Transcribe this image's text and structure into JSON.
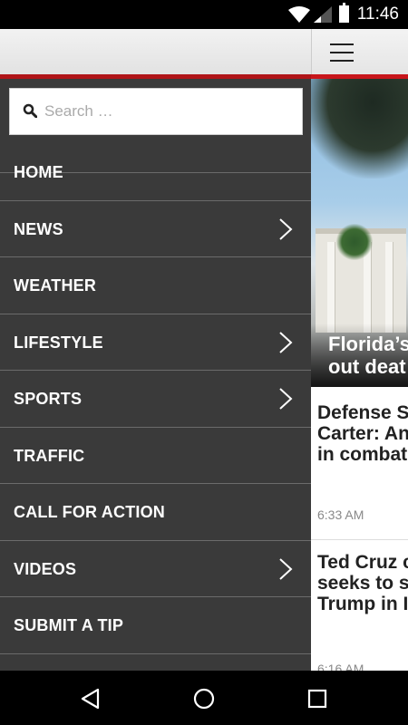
{
  "status_bar": {
    "time": "11:46",
    "icons": [
      "wifi-icon",
      "signal-icon",
      "battery-icon"
    ]
  },
  "search": {
    "placeholder": "Search …",
    "value": "",
    "icon": "search-icon"
  },
  "menu": {
    "items": [
      {
        "label": "HOME",
        "has_submenu": false
      },
      {
        "label": "NEWS",
        "has_submenu": true
      },
      {
        "label": "WEATHER",
        "has_submenu": false
      },
      {
        "label": "LIFESTYLE",
        "has_submenu": true
      },
      {
        "label": "SPORTS",
        "has_submenu": true
      },
      {
        "label": "TRAFFIC",
        "has_submenu": false
      },
      {
        "label": "CALL FOR ACTION",
        "has_submenu": false
      },
      {
        "label": "VIDEOS",
        "has_submenu": true
      },
      {
        "label": "SUBMIT A TIP",
        "has_submenu": false
      }
    ]
  },
  "content": {
    "hero_title": "Florida’s\nout deat",
    "stories": [
      {
        "title": "Defense S\nCarter: An\nin combat",
        "time": "6:33 AM"
      },
      {
        "title": "Ted Cruz c\nseeks to s\nTrump in I",
        "time": "6:16 AM"
      }
    ]
  },
  "colors": {
    "accent_red": "#c8161b",
    "drawer_bg": "#3a3a3a",
    "divider": "#6b6b6b"
  },
  "nav_bar": {
    "buttons": [
      "back-icon",
      "home-icon",
      "recents-icon"
    ]
  }
}
